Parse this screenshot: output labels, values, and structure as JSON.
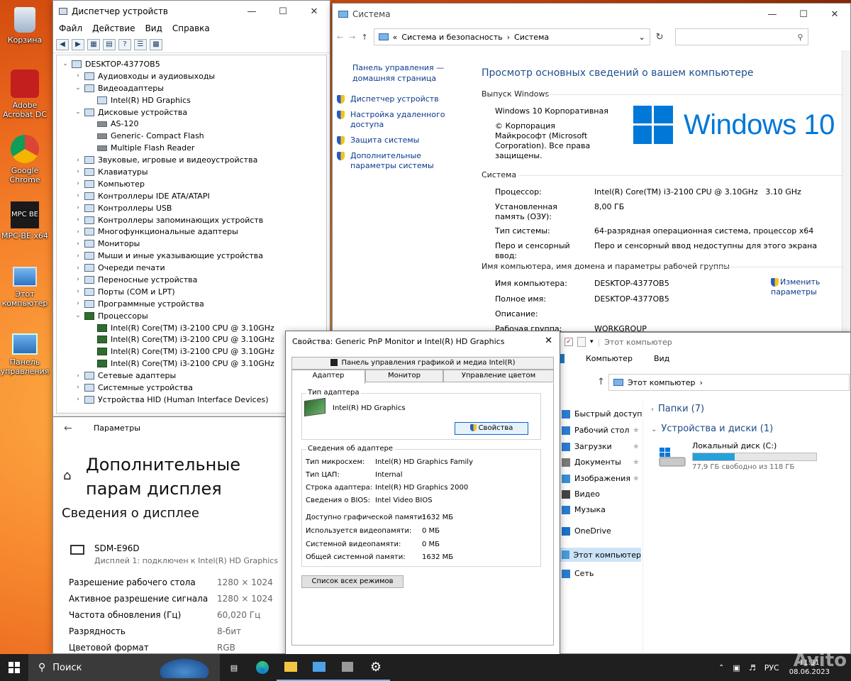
{
  "desktop": {
    "icons": [
      {
        "label": "Корзина"
      },
      {
        "label": "Adobe Acrobat DC"
      },
      {
        "label": "Google Chrome"
      },
      {
        "label": "MPC-BE x64"
      },
      {
        "label": "Этот компьютер"
      },
      {
        "label": "Панель управления"
      }
    ],
    "mpc_logo": "MPC BE"
  },
  "devmgr": {
    "title": "Диспетчер устройств",
    "menu": [
      "Файл",
      "Действие",
      "Вид",
      "Справка"
    ],
    "tree": [
      {
        "label": "DESKTOP-4377OB5",
        "lvl": 0,
        "exp": "v"
      },
      {
        "label": "Аудиовходы и аудиовыходы",
        "lvl": 1,
        "exp": ">"
      },
      {
        "label": "Видеоадаптеры",
        "lvl": 1,
        "exp": "v"
      },
      {
        "label": "Intel(R) HD Graphics",
        "lvl": 2,
        "exp": ""
      },
      {
        "label": "Дисковые устройства",
        "lvl": 1,
        "exp": "v"
      },
      {
        "label": "AS-120",
        "lvl": 2,
        "exp": "",
        "hd": true
      },
      {
        "label": "Generic- Compact Flash",
        "lvl": 2,
        "exp": "",
        "hd": true
      },
      {
        "label": "Multiple Flash Reader",
        "lvl": 2,
        "exp": "",
        "hd": true
      },
      {
        "label": "Звуковые, игровые и видеоустройства",
        "lvl": 1,
        "exp": ">"
      },
      {
        "label": "Клавиатуры",
        "lvl": 1,
        "exp": ">"
      },
      {
        "label": "Компьютер",
        "lvl": 1,
        "exp": ">"
      },
      {
        "label": "Контроллеры IDE ATA/ATAPI",
        "lvl": 1,
        "exp": ">"
      },
      {
        "label": "Контроллеры USB",
        "lvl": 1,
        "exp": ">"
      },
      {
        "label": "Контроллеры запоминающих устройств",
        "lvl": 1,
        "exp": ">"
      },
      {
        "label": "Многофункциональные адаптеры",
        "lvl": 1,
        "exp": ">"
      },
      {
        "label": "Мониторы",
        "lvl": 1,
        "exp": ">"
      },
      {
        "label": "Мыши и иные указывающие устройства",
        "lvl": 1,
        "exp": ">"
      },
      {
        "label": "Очереди печати",
        "lvl": 1,
        "exp": ">"
      },
      {
        "label": "Переносные устройства",
        "lvl": 1,
        "exp": ">"
      },
      {
        "label": "Порты (COM и LPT)",
        "lvl": 1,
        "exp": ">"
      },
      {
        "label": "Программные устройства",
        "lvl": 1,
        "exp": ">"
      },
      {
        "label": "Процессоры",
        "lvl": 1,
        "exp": "v",
        "cpu": true
      },
      {
        "label": "Intel(R) Core(TM) i3-2100 CPU @ 3.10GHz",
        "lvl": 2,
        "exp": "",
        "cpu": true
      },
      {
        "label": "Intel(R) Core(TM) i3-2100 CPU @ 3.10GHz",
        "lvl": 2,
        "exp": "",
        "cpu": true
      },
      {
        "label": "Intel(R) Core(TM) i3-2100 CPU @ 3.10GHz",
        "lvl": 2,
        "exp": "",
        "cpu": true
      },
      {
        "label": "Intel(R) Core(TM) i3-2100 CPU @ 3.10GHz",
        "lvl": 2,
        "exp": "",
        "cpu": true
      },
      {
        "label": "Сетевые адаптеры",
        "lvl": 1,
        "exp": ">"
      },
      {
        "label": "Системные устройства",
        "lvl": 1,
        "exp": ">"
      },
      {
        "label": "Устройства HID (Human Interface Devices)",
        "lvl": 1,
        "exp": ">"
      }
    ]
  },
  "system": {
    "title": "Система",
    "breadcrumb": [
      "«",
      "Система и безопасность",
      "›",
      "Система"
    ],
    "side_home": "Панель управления — домашняя страница",
    "side_links": [
      "Диспетчер устройств",
      "Настройка удаленного доступа",
      "Защита системы",
      "Дополнительные параметры системы"
    ],
    "heading": "Просмотр основных сведений о вашем компьютере",
    "edition_section": "Выпуск Windows",
    "edition": "Windows 10 Корпоративная",
    "copyright": "© Корпорация Майкрософт (Microsoft Corporation). Все права защищены.",
    "logo_text": "Windows 10",
    "system_section": "Система",
    "rows": [
      {
        "k": "Процессор:",
        "v": "Intel(R) Core(TM) i3-2100 CPU @ 3.10GHz   3.10 GHz"
      },
      {
        "k": "Установленная память (ОЗУ):",
        "v": "8,00 ГБ"
      },
      {
        "k": "Тип системы:",
        "v": "64-разрядная операционная система, процессор x64"
      },
      {
        "k": "Перо и сенсорный ввод:",
        "v": "Перо и сенсорный ввод недоступны для этого экрана"
      }
    ],
    "name_section": "Имя компьютера, имя домена и параметры рабочей группы",
    "name_rows": [
      {
        "k": "Имя компьютера:",
        "v": "DESKTOP-4377OB5"
      },
      {
        "k": "Полное имя:",
        "v": "DESKTOP-4377OB5"
      },
      {
        "k": "Описание:",
        "v": ""
      },
      {
        "k": "Рабочая группа:",
        "v": "WORKGROUP"
      }
    ],
    "change_link": "Изменить параметры"
  },
  "params": {
    "back_title": "Параметры",
    "heading": "Дополнительные парам дисплея",
    "subheading": "Сведения о дисплее",
    "monitor_name": "SDM-E96D",
    "monitor_desc": "Дисплей 1: подключен к Intel(R) HD Graphics",
    "rows": [
      {
        "k": "Разрешение рабочего стола",
        "v": "1280 × 1024"
      },
      {
        "k": "Активное разрешение сигнала",
        "v": "1280 × 1024"
      },
      {
        "k": "Частота обновления (Гц)",
        "v": "60,020 Гц"
      },
      {
        "k": "Разрядность",
        "v": "8-бит"
      },
      {
        "k": "Цветовой формат",
        "v": "RGB"
      }
    ]
  },
  "dialog": {
    "title": "Свойства: Generic PnP Monitor и Intel(R) HD Graphics",
    "tab_top": "Панель управления графикой и медиа Intel(R)",
    "tabs": [
      "Адаптер",
      "Монитор",
      "Управление цветом"
    ],
    "adapter_type_group": "Тип адаптера",
    "adapter_name": "Intel(R) HD Graphics",
    "properties_button": "Свойства",
    "info_group": "Сведения об адаптере",
    "info_rows": [
      {
        "k": "Тип микросхем:",
        "v": "Intel(R) HD Graphics Family"
      },
      {
        "k": "Тип ЦАП:",
        "v": "Internal"
      },
      {
        "k": "Строка адаптера:",
        "v": "Intel(R) HD Graphics 2000"
      },
      {
        "k": "Сведения о BIOS:",
        "v": "Intel Video BIOS"
      }
    ],
    "mem_rows": [
      {
        "k": "Доступно графической памяти:",
        "v": "1632 МБ"
      },
      {
        "k": "Используется видеопамяти:",
        "v": "0 МБ"
      },
      {
        "k": "Системной видеопамяти:",
        "v": "0 МБ"
      },
      {
        "k": "Общей системной памяти:",
        "v": "1632 МБ"
      }
    ],
    "modes_button": "Список всех режимов"
  },
  "explorer": {
    "search_placeholder": "Этот компьютер",
    "ribbon": [
      "Компьютер",
      "Вид"
    ],
    "address": "Этот компьютер",
    "nav": [
      {
        "label": "Быстрый доступ",
        "color": "#2b7cd3",
        "pin": false
      },
      {
        "label": "Рабочий стол",
        "color": "#2b7cd3",
        "pin": true
      },
      {
        "label": "Загрузки",
        "color": "#2b7cd3",
        "pin": true
      },
      {
        "label": "Документы",
        "color": "#7a7a7a",
        "pin": true
      },
      {
        "label": "Изображения",
        "color": "#3a8fd6",
        "pin": true
      },
      {
        "label": "Видео",
        "color": "#444444",
        "pin": false
      },
      {
        "label": "Музыка",
        "color": "#2b7cd3",
        "pin": false
      },
      {
        "label": "OneDrive",
        "color": "#1a73c9",
        "pin": false
      },
      {
        "label": "Этот компьютер",
        "color": "#4a9bd8",
        "pin": false
      },
      {
        "label": "Сеть",
        "color": "#2b7cd3",
        "pin": false
      }
    ],
    "folders": "Папки (7)",
    "drives": "Устройства и диски (1)",
    "drive_name": "Локальный диск (C:)",
    "drive_free": "77,9 ГБ свободно из 118 ГБ",
    "drive_used_fraction": 0.34
  },
  "taskbar": {
    "search": "Поиск",
    "lang": "РУС",
    "time": "11:31",
    "date": "08.06.2023",
    "watermark": "Avito"
  }
}
